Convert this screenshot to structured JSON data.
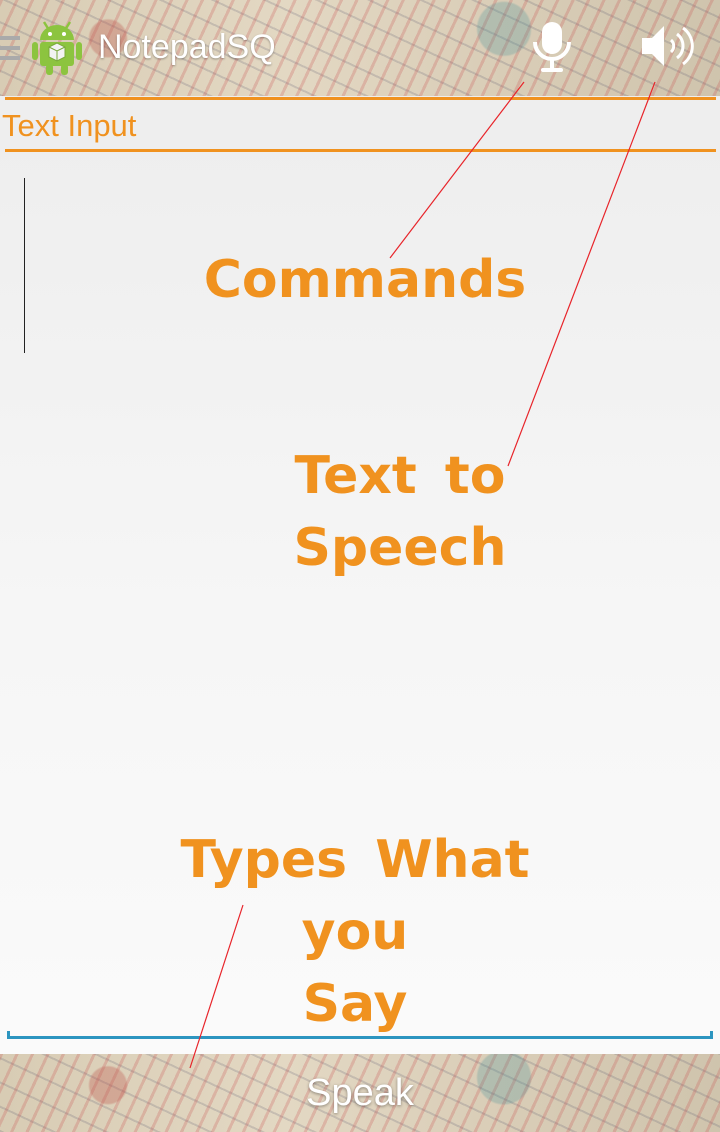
{
  "action_bar": {
    "title": "NotepadSQ",
    "icons": [
      "menu-icon",
      "android-app-icon",
      "microphone-icon",
      "speaker-icon"
    ]
  },
  "editor": {
    "section_label": "Text Input",
    "text_value": ""
  },
  "annotations": {
    "commands": "Commands",
    "tts_line1": "Text to",
    "tts_line2": "Speech",
    "types_line1": "Types What you",
    "types_line2": "Say"
  },
  "bottom_bar": {
    "speak_label": "Speak"
  },
  "colors": {
    "accent_orange": "#f0921f",
    "input_underline_blue": "#2c95c0",
    "pointer_line_red": "#e8242a"
  }
}
